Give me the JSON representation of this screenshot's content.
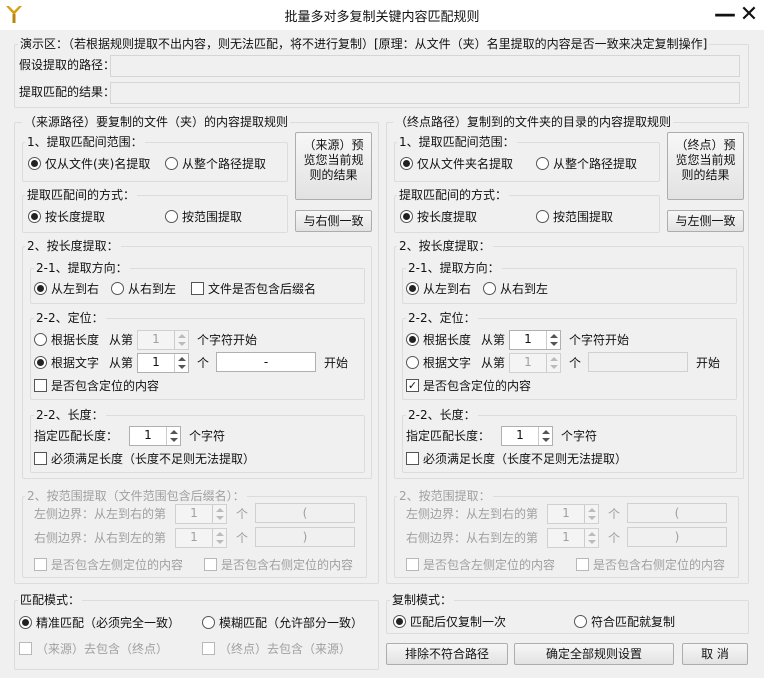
{
  "window": {
    "title": "批量多对多复制关键内容匹配规则",
    "minimize": "—",
    "close": "✕"
  },
  "demo": {
    "header": "演示区：（若根据规则提取不出内容，则无法匹配，将不进行复制）[原理：从文件（夹）名里提取的内容是否一致来决定复制操作]",
    "path_label": "假设提取的路径：",
    "path_value": "",
    "result_label": "提取匹配的结果：",
    "result_value": ""
  },
  "left": {
    "title": "（来源路径）要复制的文件（夹）的内容提取规则",
    "range_title": "1、提取匹配间范围：",
    "range_opt1": "仅从文件(夹)名提取",
    "range_opt2": "从整个路径提取",
    "preview_btn": "（来源）预览您当前规则的结果",
    "sync_btn": "与右侧一致",
    "method_title": "提取匹配间的方式：",
    "method_opt1": "按长度提取",
    "method_opt2": "按范围提取",
    "len_title": "2、按长度提取：",
    "dir_title": "2-1、提取方向：",
    "dir_opt1": "从左到右",
    "dir_opt2": "从右到左",
    "ext_chk": "文件是否包含后缀名",
    "pos_title": "2-2、定位：",
    "pos_by_len": "根据长度",
    "pos_from": "从第",
    "pos_len_val": "1",
    "pos_chars_start": "个字符开始",
    "pos_by_text": "根据文字",
    "pos_text_from": "从第",
    "pos_text_val": "1",
    "pos_text_unit": "个",
    "pos_text_box": "-",
    "pos_text_start": "开始",
    "pos_include": "是否包含定位的内容",
    "length_title": "2-2、长度：",
    "length_label": "指定匹配长度：",
    "length_val": "1",
    "length_unit": "个字符",
    "must_chk": "必须满足长度（长度不足则无法提取）",
    "rng_title": "2、按范围提取（文件范围包含后缀名）：",
    "rng_left": "左侧边界：从左到右的第",
    "rng_left_val": "1",
    "rng_left_unit": "个",
    "rng_left_box": "(",
    "rng_right": "右侧边界：从右到左的第",
    "rng_right_val": "1",
    "rng_right_unit": "个",
    "rng_right_box": ")",
    "rng_inc_left": "是否包含左侧定位的内容",
    "rng_inc_right": "是否包含右侧定位的内容"
  },
  "right": {
    "title": "（终点路径）复制到的文件夹的目录的内容提取规则",
    "range_title": "1、提取匹配间范围：",
    "range_opt1": "仅从文件夹名提取",
    "range_opt2": "从整个路径提取",
    "preview_btn": "（终点）预览您当前规则的结果",
    "sync_btn": "与左侧一致",
    "method_title": "提取匹配间的方式：",
    "method_opt1": "按长度提取",
    "method_opt2": "按范围提取",
    "len_title": "2、按长度提取：",
    "dir_title": "2-1、提取方向：",
    "dir_opt1": "从左到右",
    "dir_opt2": "从右到左",
    "pos_title": "2-2、定位：",
    "pos_by_len": "根据长度",
    "pos_from": "从第",
    "pos_len_val": "1",
    "pos_chars_start": "个字符开始",
    "pos_by_text": "根据文字",
    "pos_text_from": "从第",
    "pos_text_val": "1",
    "pos_text_unit": "个",
    "pos_text_box": "",
    "pos_text_start": "开始",
    "pos_include": "是否包含定位的内容",
    "length_title": "2-2、长度：",
    "length_label": "指定匹配长度：",
    "length_val": "1",
    "length_unit": "个字符",
    "must_chk": "必须满足长度（长度不足则无法提取）",
    "rng_title": "2、按范围提取：",
    "rng_left": "左侧边界：从左到右的第",
    "rng_left_val": "1",
    "rng_left_unit": "个",
    "rng_left_box": "(",
    "rng_right": "右侧边界：从右到左的第",
    "rng_right_val": "1",
    "rng_right_unit": "个",
    "rng_right_box": ")",
    "rng_inc_left": "是否包含左侧定位的内容",
    "rng_inc_right": "是否包含右侧定位的内容"
  },
  "match": {
    "title": "匹配模式：",
    "opt1": "精准匹配（必须完全一致）",
    "opt2": "模糊匹配（允许部分一致）",
    "chk1": "（来源）去包含（终点）",
    "chk2": "（终点）去包含（来源）"
  },
  "copy": {
    "title": "复制模式：",
    "opt1": "匹配后仅复制一次",
    "opt2": "符合匹配就复制"
  },
  "footer": {
    "exclude_btn": "排除不符合路径",
    "confirm_btn": "确定全部规则设置",
    "cancel_btn": "取 消"
  }
}
